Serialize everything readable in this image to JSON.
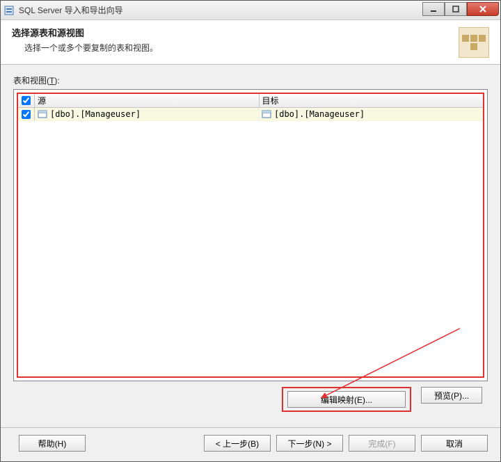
{
  "window": {
    "title": "SQL Server 导入和导出向导"
  },
  "header": {
    "title": "选择源表和源视图",
    "subtitle": "选择一个或多个要复制的表和视图。"
  },
  "list": {
    "label_prefix": "表和视图(",
    "label_hotkey": "T",
    "label_suffix": "):",
    "columns": {
      "source": "源",
      "target": "目标"
    },
    "header_checked": true,
    "rows": [
      {
        "checked": true,
        "source": "[dbo].[Manageuser]",
        "target": "[dbo].[Manageuser]"
      }
    ]
  },
  "buttons": {
    "edit_mapping": "编辑映射(E)...",
    "preview": "预览(P)...",
    "help": "帮助(H)",
    "back": "< 上一步(B)",
    "next": "下一步(N) >",
    "finish": "完成(F)",
    "cancel": "取消"
  }
}
